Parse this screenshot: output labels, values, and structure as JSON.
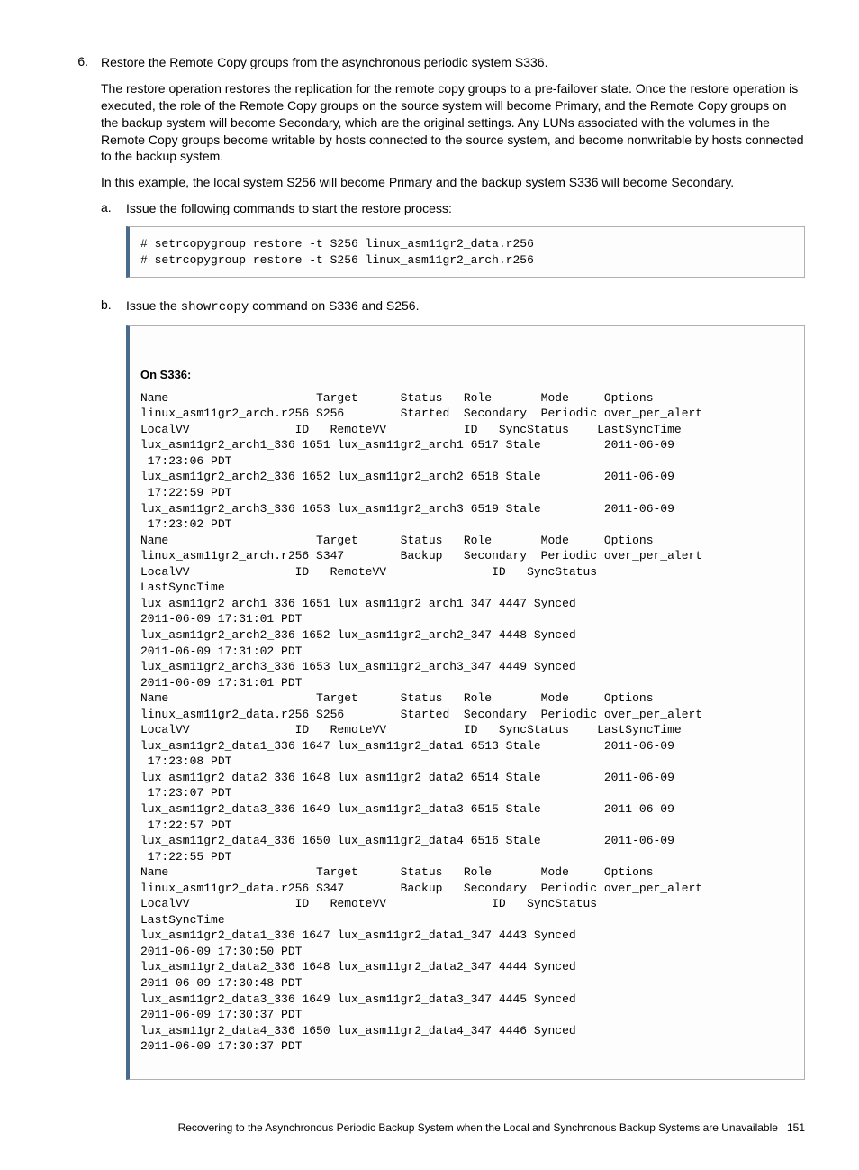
{
  "step6": {
    "num": "6.",
    "title": "Restore the Remote Copy groups from the asynchronous periodic system S336.",
    "p1": "The restore operation restores the replication for the remote copy groups to a pre-failover state. Once the restore operation is executed, the role of the Remote Copy groups on the source system will become Primary, and the Remote Copy groups on the backup system will become Secondary, which are the original settings. Any LUNs associated with the volumes in the Remote Copy groups become writable by hosts connected to the source system, and become nonwritable by hosts connected to the backup system.",
    "p2": "In this example, the local system S256 will become Primary and the backup system S336 will become Secondary.",
    "sub_a": {
      "num": "a.",
      "text": "Issue the following commands to start the restore process:",
      "code": "# setrcopygroup restore -t S256 linux_asm11gr2_data.r256\n# setrcopygroup restore -t S256 linux_asm11gr2_arch.r256"
    },
    "sub_b": {
      "num": "b.",
      "text_pre": "Issue the ",
      "text_cmd": "showrcopy",
      "text_post": " command on S336 and S256.",
      "label": "On S336:",
      "code": "Name                     Target      Status   Role       Mode     Options\nlinux_asm11gr2_arch.r256 S256        Started  Secondary  Periodic over_per_alert\nLocalVV               ID   RemoteVV           ID   SyncStatus    LastSyncTime\nlux_asm11gr2_arch1_336 1651 lux_asm11gr2_arch1 6517 Stale         2011-06-09\n 17:23:06 PDT\nlux_asm11gr2_arch2_336 1652 lux_asm11gr2_arch2 6518 Stale         2011-06-09\n 17:22:59 PDT\nlux_asm11gr2_arch3_336 1653 lux_asm11gr2_arch3 6519 Stale         2011-06-09\n 17:23:02 PDT\nName                     Target      Status   Role       Mode     Options\nlinux_asm11gr2_arch.r256 S347        Backup   Secondary  Periodic over_per_alert\nLocalVV               ID   RemoteVV               ID   SyncStatus\nLastSyncTime\nlux_asm11gr2_arch1_336 1651 lux_asm11gr2_arch1_347 4447 Synced\n2011-06-09 17:31:01 PDT\nlux_asm11gr2_arch2_336 1652 lux_asm11gr2_arch2_347 4448 Synced\n2011-06-09 17:31:02 PDT\nlux_asm11gr2_arch3_336 1653 lux_asm11gr2_arch3_347 4449 Synced\n2011-06-09 17:31:01 PDT\nName                     Target      Status   Role       Mode     Options\nlinux_asm11gr2_data.r256 S256        Started  Secondary  Periodic over_per_alert\nLocalVV               ID   RemoteVV           ID   SyncStatus    LastSyncTime\nlux_asm11gr2_data1_336 1647 lux_asm11gr2_data1 6513 Stale         2011-06-09\n 17:23:08 PDT\nlux_asm11gr2_data2_336 1648 lux_asm11gr2_data2 6514 Stale         2011-06-09\n 17:23:07 PDT\nlux_asm11gr2_data3_336 1649 lux_asm11gr2_data3 6515 Stale         2011-06-09\n 17:22:57 PDT\nlux_asm11gr2_data4_336 1650 lux_asm11gr2_data4 6516 Stale         2011-06-09\n 17:22:55 PDT\nName                     Target      Status   Role       Mode     Options\nlinux_asm11gr2_data.r256 S347        Backup   Secondary  Periodic over_per_alert\nLocalVV               ID   RemoteVV               ID   SyncStatus\nLastSyncTime\nlux_asm11gr2_data1_336 1647 lux_asm11gr2_data1_347 4443 Synced\n2011-06-09 17:30:50 PDT\nlux_asm11gr2_data2_336 1648 lux_asm11gr2_data2_347 4444 Synced\n2011-06-09 17:30:48 PDT\nlux_asm11gr2_data3_336 1649 lux_asm11gr2_data3_347 4445 Synced\n2011-06-09 17:30:37 PDT\nlux_asm11gr2_data4_336 1650 lux_asm11gr2_data4_347 4446 Synced\n2011-06-09 17:30:37 PDT"
    }
  },
  "footer": {
    "text": "Recovering to the Asynchronous Periodic Backup System when the Local and Synchronous Backup Systems are Unavailable",
    "page": "151"
  }
}
